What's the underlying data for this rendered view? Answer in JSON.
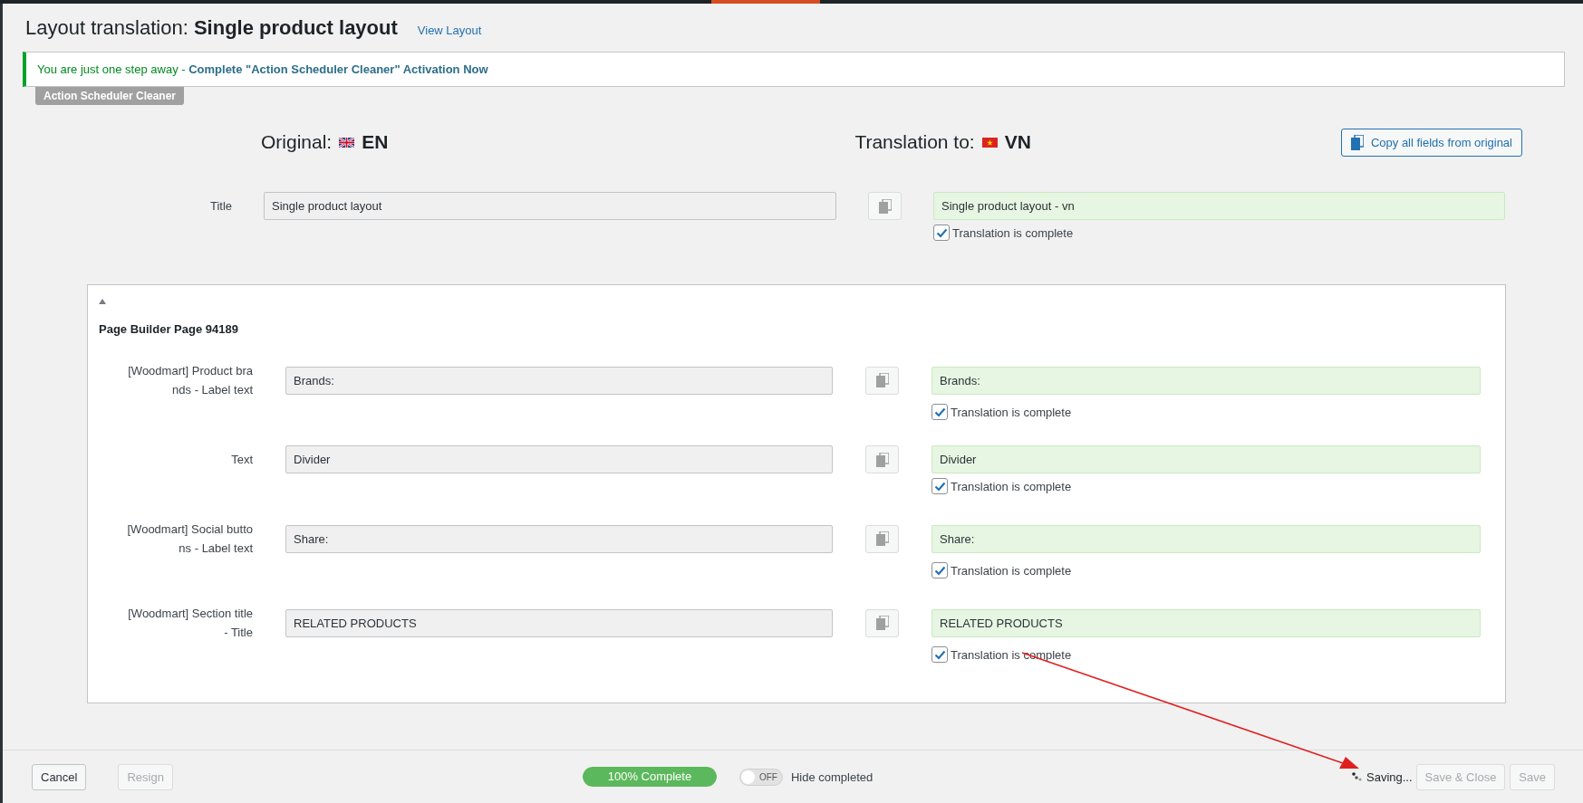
{
  "header": {
    "title_prefix": "Layout translation: ",
    "title": "Single product layout",
    "view_link": "View Layout"
  },
  "notice": {
    "text": "You are just one step away - ",
    "link": "Complete \"Action Scheduler Cleaner\" Activation Now",
    "badge": "Action Scheduler Cleaner"
  },
  "columns": {
    "original_label": "Original:",
    "original_lang": "EN",
    "translation_label": "Translation to:",
    "translation_lang": "VN",
    "copy_all": "Copy all fields from original"
  },
  "title_field": {
    "label_lines": [
      "Title"
    ],
    "original": "Single product layout",
    "translation": "Single product layout - vn",
    "complete_label": "Translation is complete",
    "checked": true
  },
  "section": {
    "expanded": true,
    "title": "Page Builder Page 94189",
    "fields": [
      {
        "label_lines": [
          "[Woodmart] Product bra",
          "nds - Label text"
        ],
        "original": "Brands:",
        "translation": "Brands:",
        "complete_label": "Translation is complete",
        "checked": true
      },
      {
        "label_lines": [
          "Text"
        ],
        "original": "Divider",
        "translation": "Divider",
        "complete_label": "Translation is complete",
        "checked": true
      },
      {
        "label_lines": [
          "[Woodmart] Social butto",
          "ns - Label text"
        ],
        "original": "Share:",
        "translation": "Share:",
        "complete_label": "Translation is complete",
        "checked": true
      },
      {
        "label_lines": [
          "[Woodmart] Section title",
          "- Title"
        ],
        "original": "RELATED PRODUCTS",
        "translation": "RELATED PRODUCTS",
        "complete_label": "Translation is complete",
        "checked": true
      }
    ]
  },
  "footer": {
    "cancel": {
      "label": "Cancel",
      "disabled": false
    },
    "resign": {
      "label": "Resign",
      "disabled": true
    },
    "progress": {
      "label": "100% Complete",
      "level": 1.0
    },
    "hide_toggle": {
      "state_label": "OFF",
      "on": false,
      "label": "Hide completed"
    },
    "saving": "Saving...",
    "save_close": {
      "label": "Save & Close",
      "disabled": true
    },
    "save": {
      "label": "Save",
      "disabled": true
    }
  }
}
